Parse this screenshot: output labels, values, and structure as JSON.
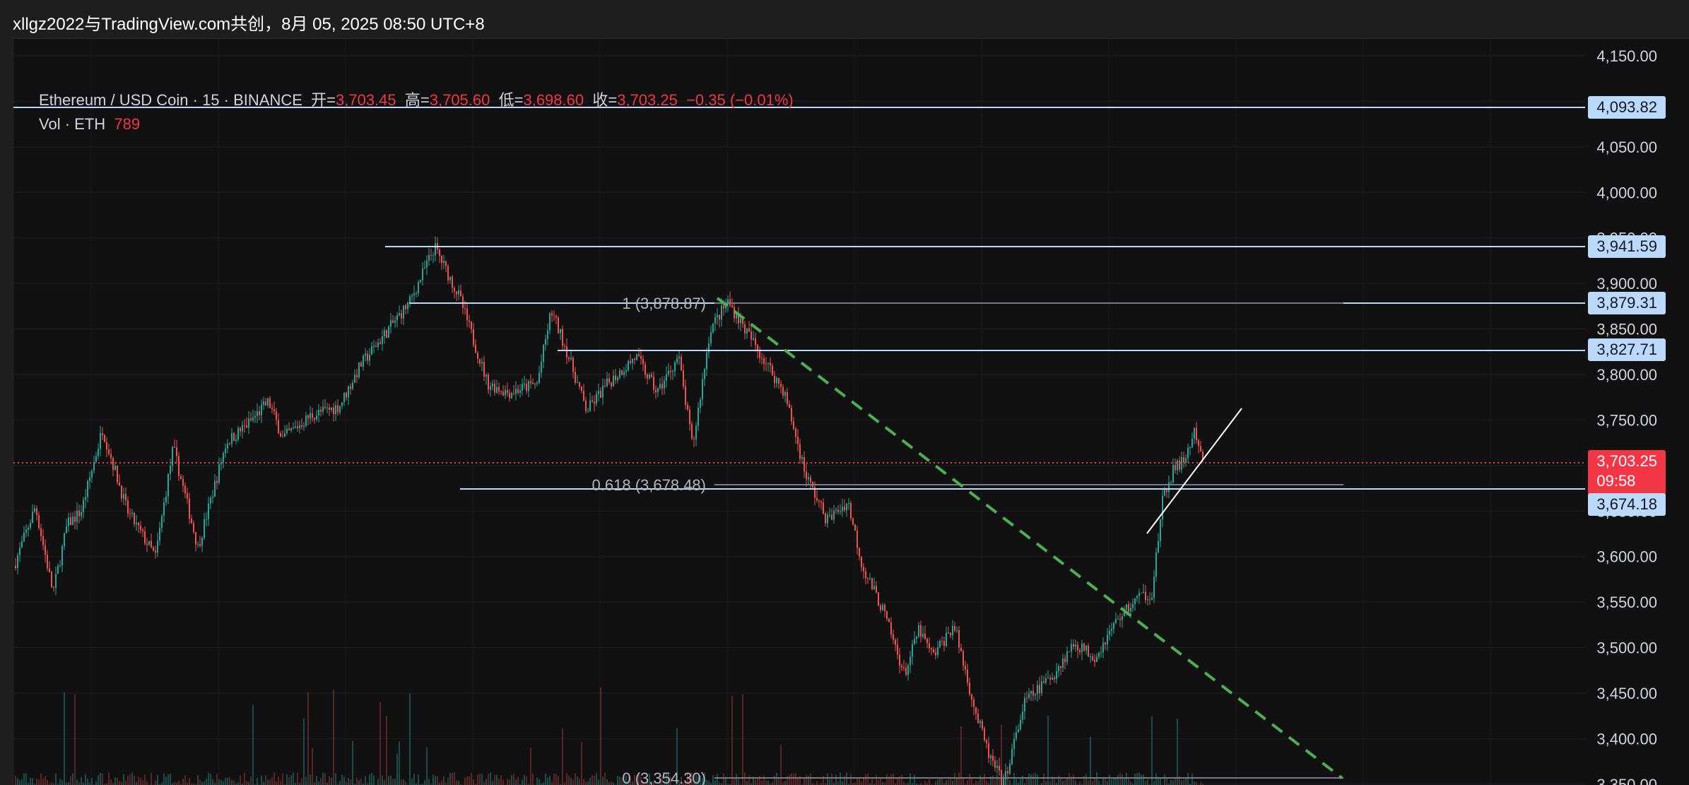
{
  "titlebar": {
    "text": "xllgz2022与TradingView.com共创，8月 05, 2025 08:50 UTC+8"
  },
  "legend": {
    "symbol": "Ethereum / USD Coin · 15 · BINANCE",
    "open_label": "开=",
    "open": "3,703.45",
    "high_label": "高=",
    "high": "3,705.60",
    "low_label": "低=",
    "low": "3,698.60",
    "close_label": "收=",
    "close": "3,703.25",
    "change": "−0.35 (−0.01%)",
    "vol_label": "Vol · ETH",
    "vol_value": "789"
  },
  "price_axis": {
    "ticks": [
      "4,150.00",
      "4,100.00",
      "4,050.00",
      "4,000.00",
      "3,950.00",
      "3,900.00",
      "3,850.00",
      "3,800.00",
      "3,750.00",
      "3,700.00",
      "3,650.00",
      "3,600.00",
      "3,550.00",
      "3,500.00",
      "3,450.00",
      "3,400.00",
      "3,350.00"
    ]
  },
  "levels": {
    "l4093": "4,093.82",
    "l3941": "3,941.59",
    "l3879": "3,879.31",
    "l3827": "3,827.71",
    "l3674": "3,674.18"
  },
  "current_price": {
    "price": "3,703.25",
    "countdown": "09:58"
  },
  "fib": {
    "level_1": "1 (3,878.87)",
    "level_0618": "0.618 (3,678.48)",
    "level_0": "0 (3,354.30)"
  },
  "colors": {
    "up": "#26a69a",
    "down": "#ef5350",
    "hline": "#bbd9fb",
    "trend": "#4caf50",
    "price_line": "#f23645"
  }
}
